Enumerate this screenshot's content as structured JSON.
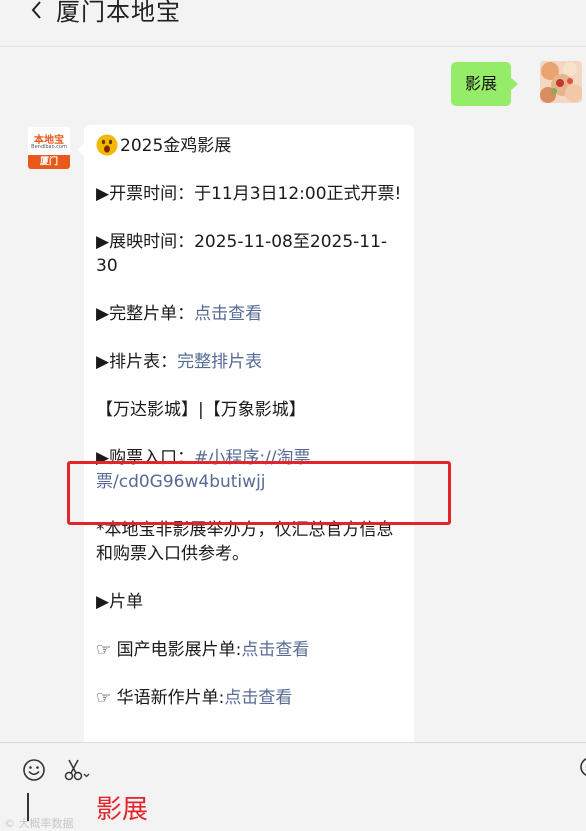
{
  "header": {
    "title": "厦门本地宝"
  },
  "outgoing": {
    "text": "影展"
  },
  "bot": {
    "avatar_top": "本地宝",
    "avatar_site": "Bendibao.com",
    "avatar_city": "厦门"
  },
  "message": {
    "title": "2025金鸡影展",
    "ticket_time": "▶开票时间：于11月3日12:00正式开票!",
    "screen_time_label": "▶展映时间：",
    "screen_time_value": "2025-11-08至2025-11-30",
    "full_list_label": "▶完整片单：",
    "full_list_link": "点击查看",
    "schedule_label": "▶排片表：",
    "schedule_link": "完整排片表",
    "cinema_1": "【万达影城】",
    "cinema_sep": "|",
    "cinema_2": "【万象影城】",
    "purchase_label": "▶购票入口：",
    "purchase_link": "#小程序://淘票票/cd0G96w4butiwjj",
    "disclaimer": "*本地宝非影展举办方，仅汇总官方信息和购票入口供参考。",
    "films_label": "▶片单",
    "domestic_label": "☞ 国产电影展片单:",
    "domestic_link": "点击查看",
    "chinese_label": "☞ 华语新作片单:",
    "chinese_link": "点击查看"
  },
  "input": {
    "text": "影展",
    "watermark": "© 大概率数据"
  },
  "colors": {
    "accent_red": "#e0262a",
    "bubble_green": "#95ec69",
    "link_blue": "#576b95",
    "brand_orange": "#e85a1b"
  }
}
